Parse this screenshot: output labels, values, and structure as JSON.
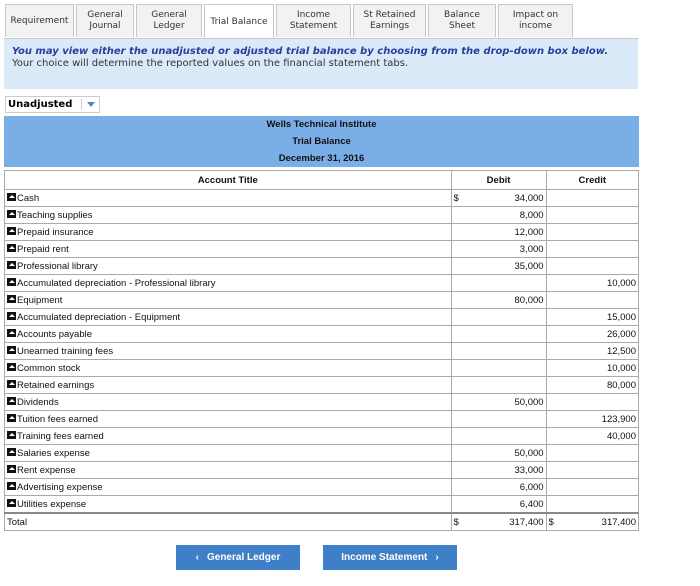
{
  "tabs": [
    {
      "label": "Requirement",
      "active": false
    },
    {
      "label": "General Journal",
      "active": false
    },
    {
      "label": "General Ledger",
      "active": false
    },
    {
      "label": "Trial Balance",
      "active": true
    },
    {
      "label": "Income Statement",
      "active": false
    },
    {
      "label": "St Retained Earnings",
      "active": false
    },
    {
      "label": "Balance Sheet",
      "active": false
    },
    {
      "label": "Impact on income",
      "active": false
    }
  ],
  "info": {
    "emphasis": "You may view either the unadjusted or adjusted trial balance by choosing from the drop-down box below.",
    "text": "Your choice will determine the reported values on the financial statement tabs."
  },
  "dropdown": {
    "value": "Unadjusted"
  },
  "header": {
    "company": "Wells Technical Institute",
    "title": "Trial Balance",
    "date": "December 31, 2016"
  },
  "table": {
    "columns": {
      "account": "Account Title",
      "debit": "Debit",
      "credit": "Credit"
    },
    "currency": "$",
    "rows": [
      {
        "account": "Cash",
        "debit": "34,000",
        "credit": ""
      },
      {
        "account": "Teaching supplies",
        "debit": "8,000",
        "credit": ""
      },
      {
        "account": "Prepaid insurance",
        "debit": "12,000",
        "credit": ""
      },
      {
        "account": "Prepaid rent",
        "debit": "3,000",
        "credit": ""
      },
      {
        "account": "Professional library",
        "debit": "35,000",
        "credit": ""
      },
      {
        "account": "Accumulated depreciation - Professional library",
        "debit": "",
        "credit": "10,000"
      },
      {
        "account": "Equipment",
        "debit": "80,000",
        "credit": ""
      },
      {
        "account": "Accumulated depreciation - Equipment",
        "debit": "",
        "credit": "15,000"
      },
      {
        "account": "Accounts payable",
        "debit": "",
        "credit": "26,000"
      },
      {
        "account": "Unearned training fees",
        "debit": "",
        "credit": "12,500"
      },
      {
        "account": "Common stock",
        "debit": "",
        "credit": "10,000"
      },
      {
        "account": "Retained earnings",
        "debit": "",
        "credit": "80,000"
      },
      {
        "account": "Dividends",
        "debit": "50,000",
        "credit": ""
      },
      {
        "account": "Tuition fees earned",
        "debit": "",
        "credit": "123,900"
      },
      {
        "account": "Training fees earned",
        "debit": "",
        "credit": "40,000"
      },
      {
        "account": "Salaries expense",
        "debit": "50,000",
        "credit": ""
      },
      {
        "account": "Rent expense",
        "debit": "33,000",
        "credit": ""
      },
      {
        "account": "Advertising expense",
        "debit": "6,000",
        "credit": ""
      },
      {
        "account": "Utilities expense",
        "debit": "6,400",
        "credit": ""
      }
    ],
    "total": {
      "label": "Total",
      "debit": "317,400",
      "credit": "317,400"
    }
  },
  "nav": {
    "prev": "General Ledger",
    "next": "Income Statement"
  }
}
